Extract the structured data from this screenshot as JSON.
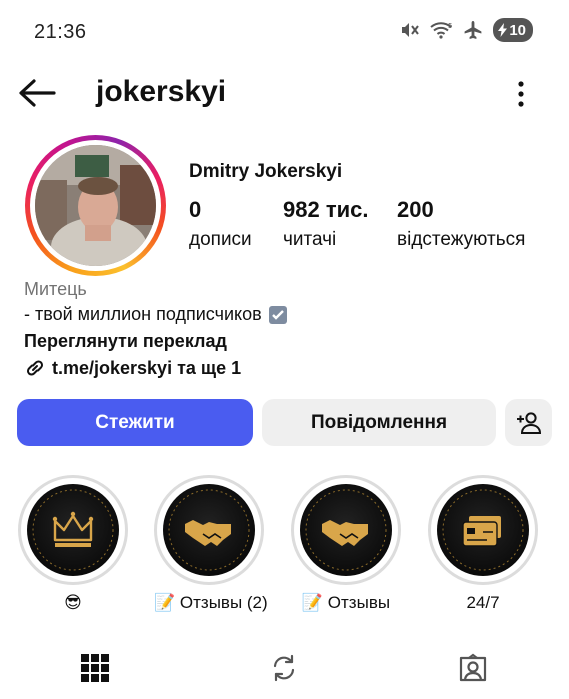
{
  "status": {
    "time": "21:36",
    "battery": "10"
  },
  "profile": {
    "username": "jokerskyi",
    "full_name": "Dmitry Jokerskyi",
    "stats": [
      {
        "value": "0",
        "label": "дописи"
      },
      {
        "value": "982 тис.",
        "label": "читачі"
      },
      {
        "value": "200",
        "label": "відстежуються"
      }
    ],
    "category": "Митець",
    "bio": "- твой миллион подписчиков",
    "translate_label": "Переглянути переклад",
    "link": "t.me/jokerskyi та ще 1"
  },
  "actions": {
    "follow": "Стежити",
    "message": "Повідомлення"
  },
  "highlights": [
    {
      "label": "😎",
      "icon": "crown-icon"
    },
    {
      "label": "📝 Отзывы (2)",
      "icon": "handshake-icon"
    },
    {
      "label": "📝 Отзывы",
      "icon": "handshake-icon"
    },
    {
      "label": "24/7",
      "icon": "card-icon"
    }
  ],
  "nav": [
    "grid-icon",
    "reels-icon",
    "tagged-icon"
  ],
  "colors": {
    "accent": "#4a5cf0",
    "gold": "#d9a64a",
    "secondary_bg": "#efefef"
  }
}
